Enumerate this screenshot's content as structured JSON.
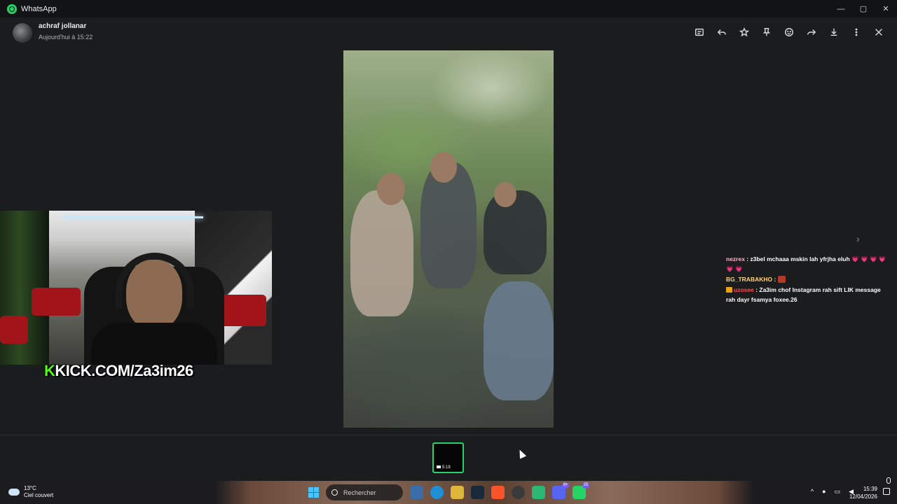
{
  "app": {
    "title": "WhatsApp",
    "brand_color": "#25d366"
  },
  "window_controls": {
    "minimize": "—",
    "maximize": "▢",
    "close": "✕"
  },
  "header": {
    "contact_name": "achraf jollanar",
    "timestamp": "Aujourd'hui à 15:22",
    "toolbar_icons": [
      "message-icon",
      "reply-icon",
      "star-icon",
      "pin-icon",
      "emoji-icon",
      "forward-icon",
      "download-icon",
      "more-icon",
      "close-icon"
    ]
  },
  "stream_overlay": {
    "kick_prefix": "K",
    "kick_text": "KICK.COM/Za3im26"
  },
  "chat": [
    {
      "user": "nezrex",
      "sep": " : ",
      "text": "z3bel mchaaa mskin lah yfrjha eluh",
      "hearts": "💗 💗 💗 💗 💗 💗"
    },
    {
      "user": "BG_TRABAKHO",
      "sep": " : ",
      "text": ""
    },
    {
      "user": "uzosee",
      "sep": " : ",
      "text": "Za3im chof Instagram rah sift LIK message rah dayr fsamya foxee.26"
    }
  ],
  "thumbnail": {
    "duration": "5:19"
  },
  "taskbar": {
    "temperature": "13°C",
    "weather": "Ciel couvert",
    "search_label": "Rechercher",
    "badges": {
      "discord": "9+",
      "whatsapp": "25"
    },
    "time": "15:39",
    "date": "12/04/2026"
  }
}
